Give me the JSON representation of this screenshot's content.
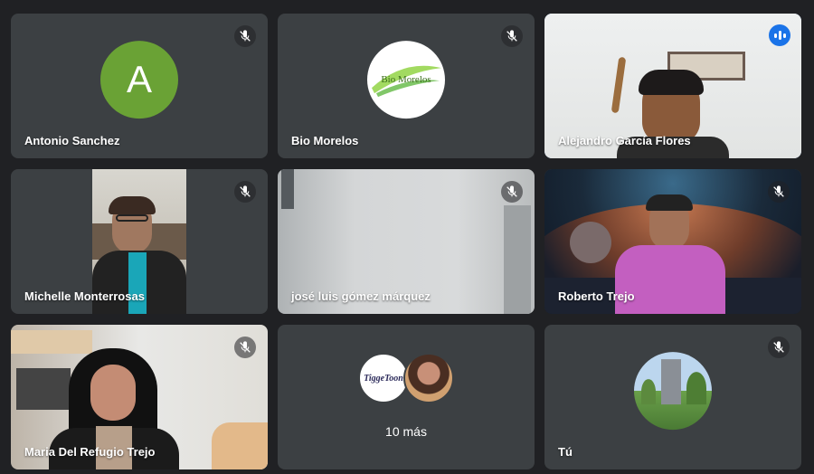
{
  "participants": [
    {
      "name": "Antonio Sanchez",
      "initial": "A",
      "muted": true
    },
    {
      "name": "Bio Morelos",
      "avatar_text": "Bio Morelos",
      "muted": true
    },
    {
      "name": "Alejandro García Flores",
      "speaking": true
    },
    {
      "name": "Michelle Monterrosas",
      "muted": true
    },
    {
      "name": "josé luis gómez márquez",
      "muted": true
    },
    {
      "name": "Roberto Trejo",
      "muted": true
    },
    {
      "name": "Maria Del Refugio Trejo",
      "muted": true
    },
    {
      "more_label": "10 más",
      "avatar_text": "TiggeToon"
    },
    {
      "name": "Tú",
      "muted": true
    }
  ],
  "colors": {
    "background": "#202124",
    "tile": "#3c4043",
    "active_outline": "#8ab4f8",
    "speaking": "#1a73e8",
    "avatar_green": "#6aa235"
  }
}
